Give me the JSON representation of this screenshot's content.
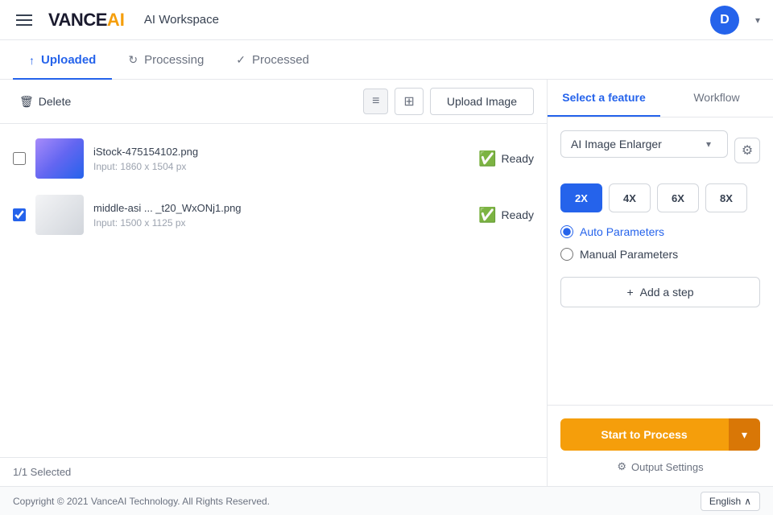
{
  "header": {
    "menu_icon": "hamburger-icon",
    "logo_text": "VANCE",
    "logo_accent": "AI",
    "workspace": "AI Workspace",
    "user_initial": "D",
    "chevron": "▾"
  },
  "tabs": [
    {
      "id": "uploaded",
      "label": "Uploaded",
      "icon": "↑",
      "active": true
    },
    {
      "id": "processing",
      "label": "Processing",
      "icon": "↻",
      "active": false
    },
    {
      "id": "processed",
      "label": "Processed",
      "icon": "✓",
      "active": false
    }
  ],
  "toolbar": {
    "delete_label": "Delete",
    "delete_icon": "🗑",
    "view_list_icon": "≡",
    "view_grid_icon": "⊞",
    "upload_button": "Upload Image"
  },
  "images": [
    {
      "id": "img1",
      "name": "iStock-475154102.png",
      "size": "Input: 1860 x 1504 px",
      "status": "Ready",
      "checked": false,
      "thumb_type": "face"
    },
    {
      "id": "img2",
      "name": "middle-asi ... _t20_WxONj1.png",
      "size": "Input: 1500 x 1125 px",
      "status": "Ready",
      "checked": true,
      "thumb_type": "person"
    }
  ],
  "left_footer": {
    "selected_text": "1/1 Selected"
  },
  "right_panel": {
    "tabs": [
      {
        "id": "feature",
        "label": "Select a feature",
        "active": true
      },
      {
        "id": "workflow",
        "label": "Workflow",
        "active": false
      }
    ],
    "feature_dropdown": {
      "label": "AI Image Enlarger",
      "arrow": "▾"
    },
    "scale_options": [
      {
        "value": "2X",
        "active": true
      },
      {
        "value": "4X",
        "active": false
      },
      {
        "value": "6X",
        "active": false
      },
      {
        "value": "8X",
        "active": false
      }
    ],
    "parameters": [
      {
        "id": "auto",
        "label": "Auto Parameters",
        "checked": true
      },
      {
        "id": "manual",
        "label": "Manual Parameters",
        "checked": false
      }
    ],
    "add_step_label": "+ Add a step",
    "process_button": "Start to Process",
    "process_dropdown": "▾",
    "output_settings_label": "Output Settings",
    "gear_icon": "⚙"
  },
  "footer": {
    "copyright": "Copyright © 2021 VanceAI Technology. All Rights Reserved.",
    "language": "English",
    "chevron_up": "∧"
  }
}
